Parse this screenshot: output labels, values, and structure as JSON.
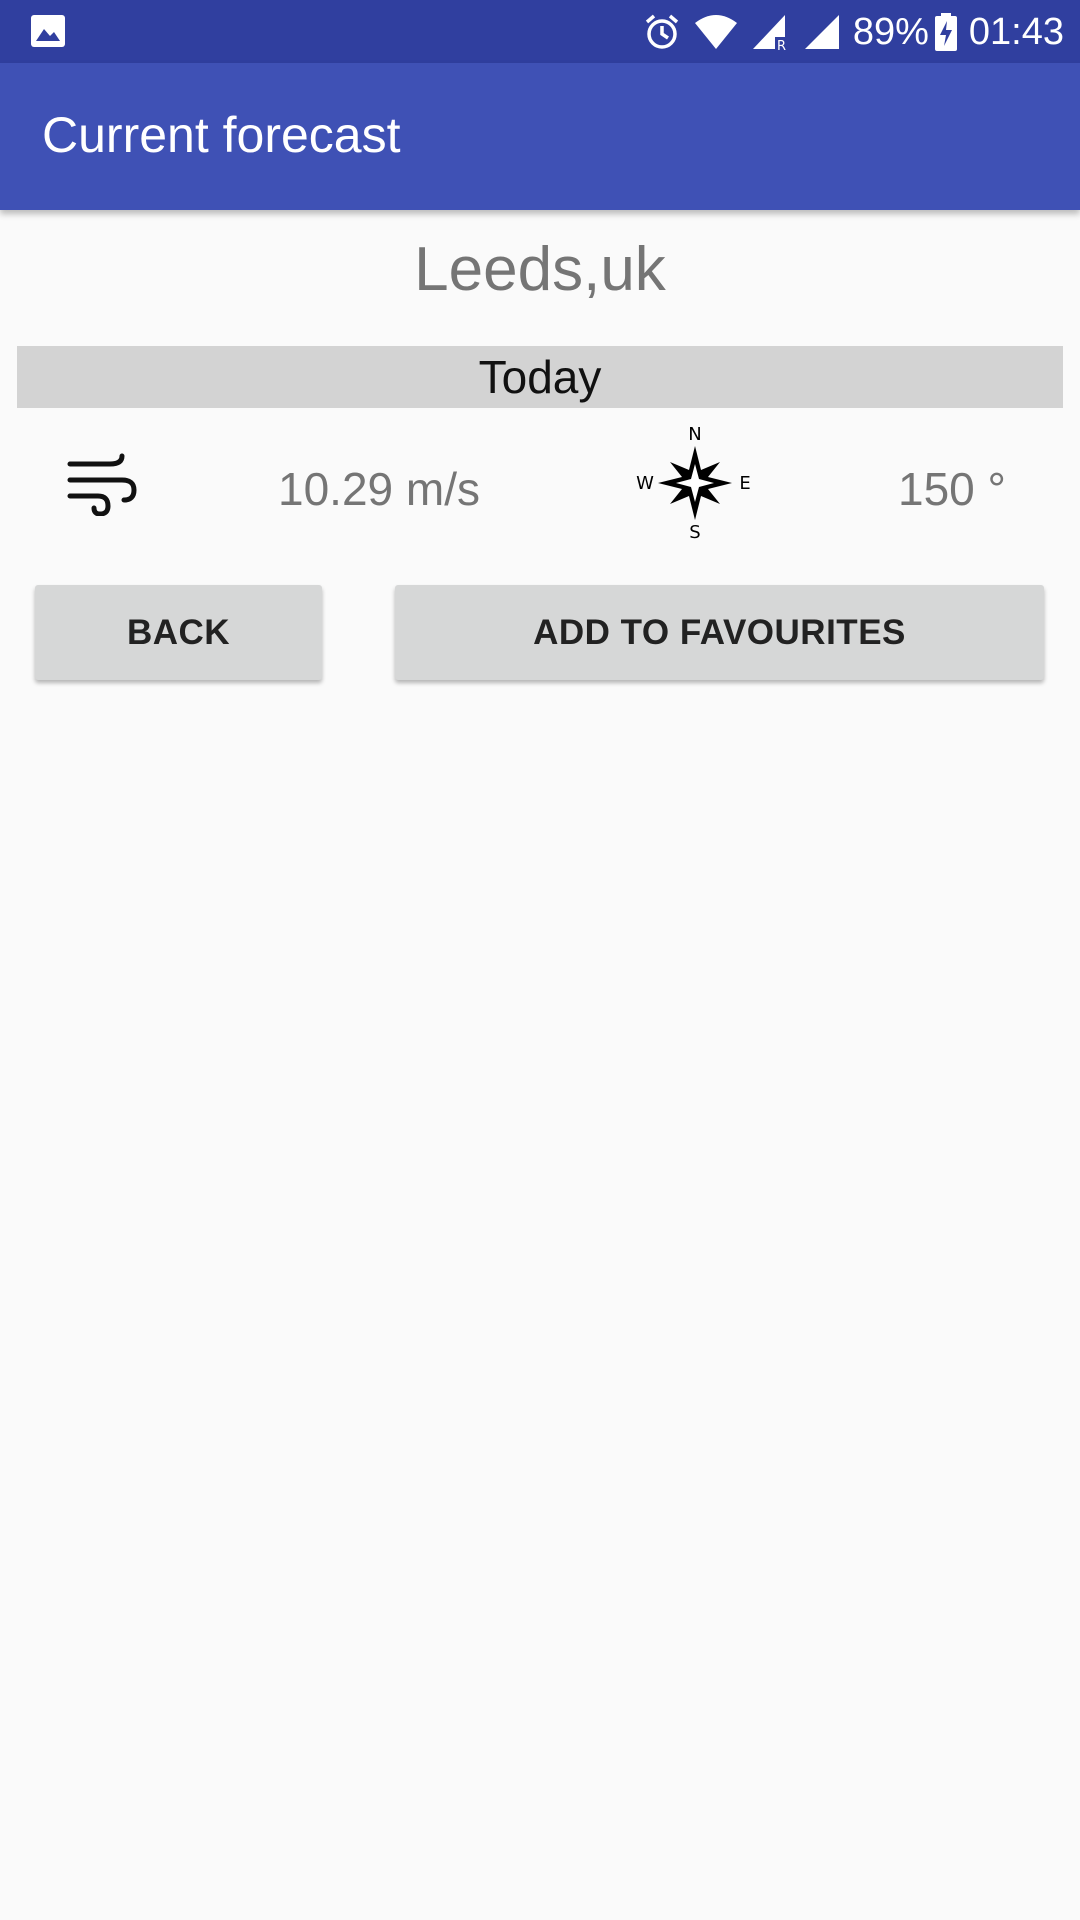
{
  "status_bar": {
    "battery": "89%",
    "time": "01:43",
    "icons": [
      "image-icon",
      "alarm-icon",
      "wifi-icon",
      "signal-r-icon",
      "signal-icon",
      "battery-charging-icon"
    ]
  },
  "app_bar": {
    "title": "Current forecast"
  },
  "location": {
    "city": "Leeds,uk"
  },
  "forecast": {
    "day_label": "Today",
    "wind_speed": "10.29 m/s",
    "wind_direction": "150 °",
    "compass_labels": {
      "n": "N",
      "s": "S",
      "e": "E",
      "w": "W"
    }
  },
  "buttons": {
    "back": "BACK",
    "favourites": "ADD TO FAVOURITES"
  },
  "colors": {
    "status_bar": "#303f9f",
    "app_bar": "#3f51b5",
    "day_bar": "#d3d3d3",
    "button": "#d6d7d7"
  }
}
